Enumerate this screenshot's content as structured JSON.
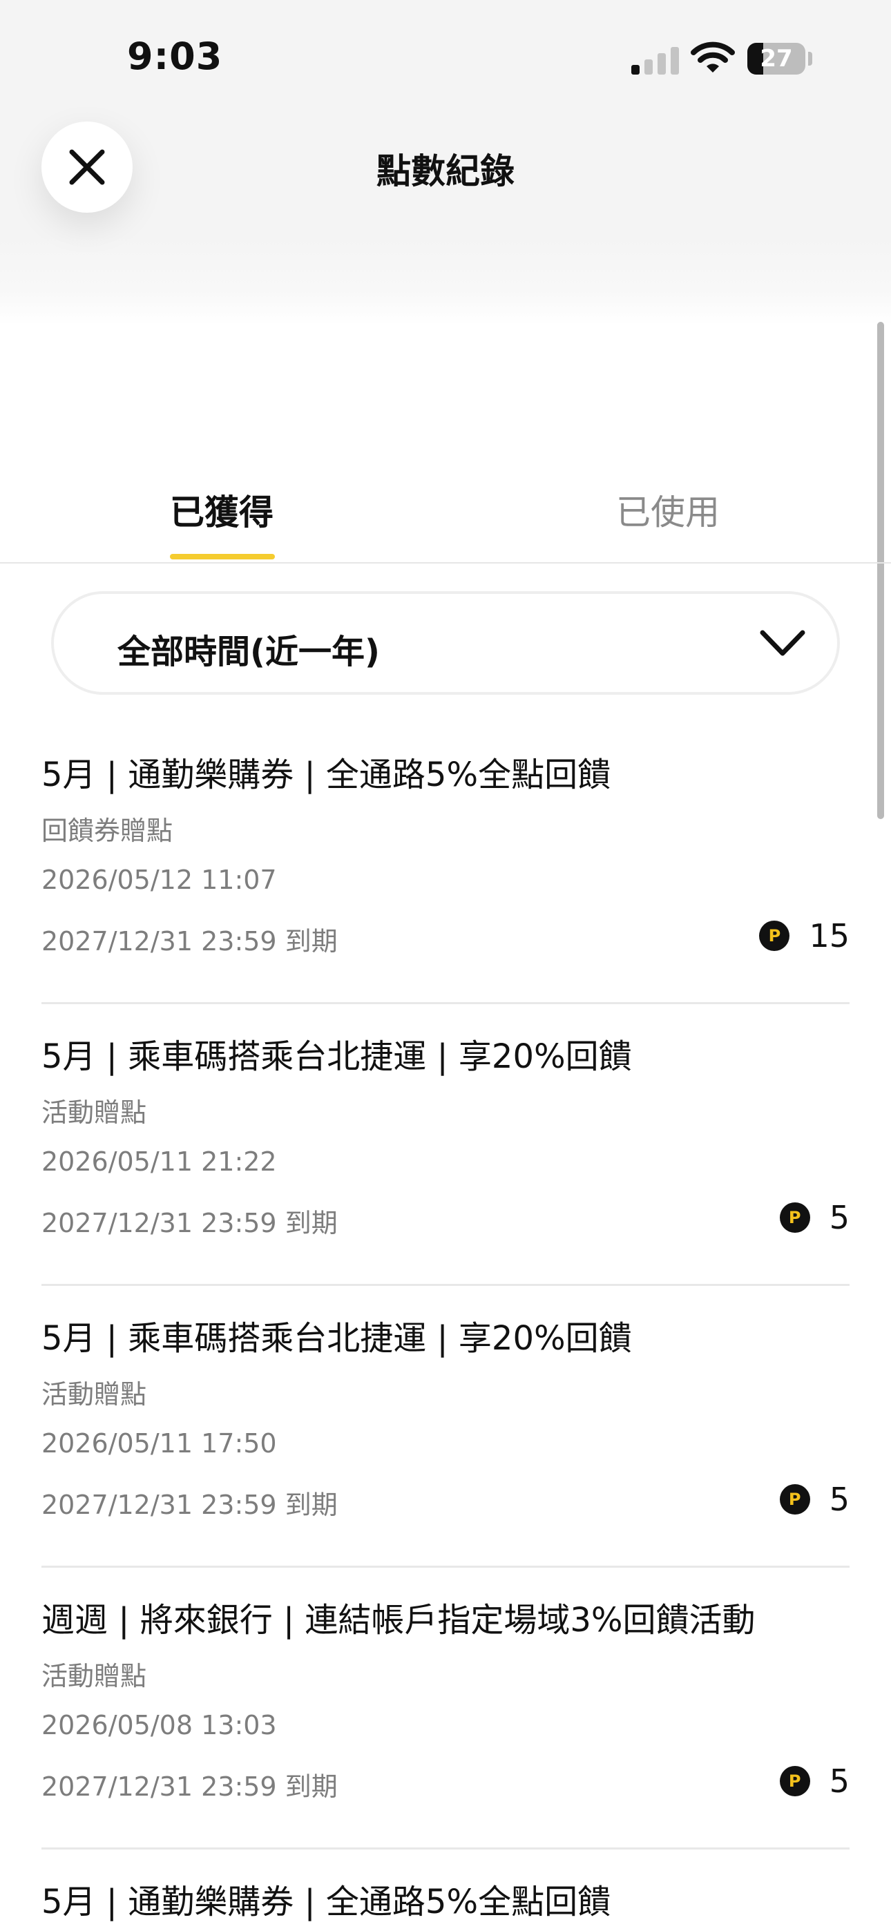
{
  "status_bar": {
    "time": "9:03",
    "battery_level": "27",
    "battery_fraction": 0.27
  },
  "header": {
    "title": "點數紀錄",
    "close_icon": "close-icon"
  },
  "tabs": [
    {
      "label": "已獲得",
      "selected": true
    },
    {
      "label": "已使用",
      "selected": false
    }
  ],
  "filter": {
    "selected": "全部時間(近一年)",
    "icon": "chevron-down-icon"
  },
  "colors": {
    "accent": "#F5CC2F",
    "coin_background": "#111111",
    "coin_letter": "#F5C21C"
  },
  "points_icon_letter": "P",
  "records": [
    {
      "title": "5月 | 通勤樂購券 | 全通路5%全點回饋",
      "type": "回饋券贈點",
      "date": "2026/05/12 11:07",
      "expiry": "2027/12/31 23:59 到期",
      "points": "15"
    },
    {
      "title": "5月 | 乘車碼搭乘台北捷運 | 享20%回饋",
      "type": "活動贈點",
      "date": "2026/05/11 21:22",
      "expiry": "2027/12/31 23:59 到期",
      "points": "5"
    },
    {
      "title": "5月 | 乘車碼搭乘台北捷運 | 享20%回饋",
      "type": "活動贈點",
      "date": "2026/05/11 17:50",
      "expiry": "2027/12/31 23:59 到期",
      "points": "5"
    },
    {
      "title": "週週 | 將來銀行 | 連結帳戶指定場域3%回饋活動",
      "type": "活動贈點",
      "date": "2026/05/08 13:03",
      "expiry": "2027/12/31 23:59 到期",
      "points": "5"
    },
    {
      "title": "5月 | 通勤樂購券 | 全通路5%全點回饋",
      "type": "",
      "date": "",
      "expiry": "",
      "points": ""
    }
  ]
}
